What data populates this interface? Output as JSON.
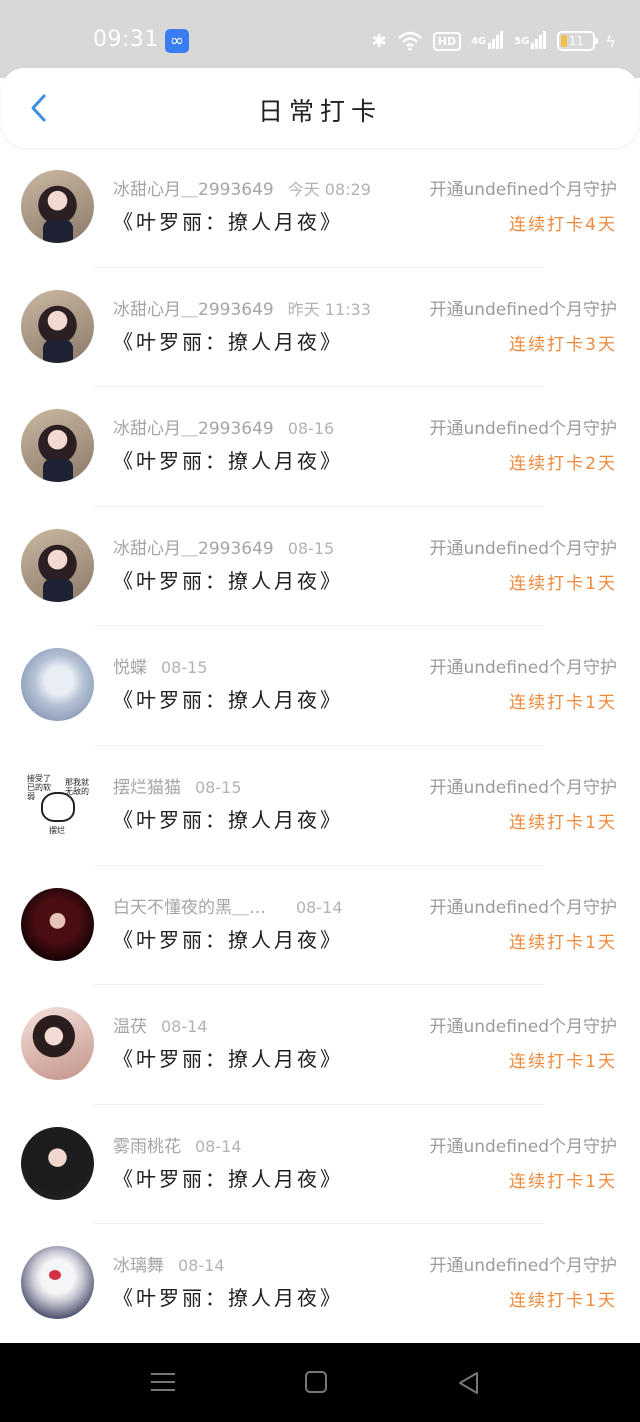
{
  "status_bar": {
    "time": "09:31",
    "app_icon": "infinity-app-icon",
    "hd_label": "HD",
    "net1_label": "4G",
    "net2_label": "5G",
    "battery": "11"
  },
  "header": {
    "title": "日常打卡",
    "back_icon": "chevron-left-icon"
  },
  "colors": {
    "accent": "#3a8ee6",
    "streak": "#ef8a3c",
    "meta_text": "#a5a5a5"
  },
  "items": [
    {
      "name": "冰甜心月＿2993649",
      "date": "今天 08:29",
      "guard": "开通undefined个月守护",
      "book": "《叶罗丽：撩人月夜》",
      "streak": "连续打卡4天",
      "avatar": "girl"
    },
    {
      "name": "冰甜心月＿2993649",
      "date": "昨天 11:33",
      "guard": "开通undefined个月守护",
      "book": "《叶罗丽：撩人月夜》",
      "streak": "连续打卡3天",
      "avatar": "girl"
    },
    {
      "name": "冰甜心月＿2993649",
      "date": "08-16",
      "guard": "开通undefined个月守护",
      "book": "《叶罗丽：撩人月夜》",
      "streak": "连续打卡2天",
      "avatar": "girl"
    },
    {
      "name": "冰甜心月＿2993649",
      "date": "08-15",
      "guard": "开通undefined个月守护",
      "book": "《叶罗丽：撩人月夜》",
      "streak": "连续打卡1天",
      "avatar": "girl"
    },
    {
      "name": "悦蝶",
      "date": "08-15",
      "guard": "开通undefined个月守护",
      "book": "《叶罗丽：撩人月夜》",
      "streak": "连续打卡1天",
      "avatar": "white"
    },
    {
      "name": "摆烂猫猫",
      "date": "08-15",
      "guard": "开通undefined个月守护",
      "book": "《叶罗丽：撩人月夜》",
      "streak": "连续打卡1天",
      "avatar": "meme"
    },
    {
      "name": "白天不懂夜的黑＿…",
      "date": "08-14",
      "guard": "开通undefined个月守护",
      "book": "《叶罗丽：撩人月夜》",
      "streak": "连续打卡1天",
      "avatar": "red"
    },
    {
      "name": "温茯",
      "date": "08-14",
      "guard": "开通undefined个月守护",
      "book": "《叶罗丽：撩人月夜》",
      "streak": "连续打卡1天",
      "avatar": "lady"
    },
    {
      "name": "雾雨桃花",
      "date": "08-14",
      "guard": "开通undefined个月守护",
      "book": "《叶罗丽：撩人月夜》",
      "streak": "连续打卡1天",
      "avatar": "dark"
    },
    {
      "name": "冰璃舞",
      "date": "08-14",
      "guard": "开通undefined个月守护",
      "book": "《叶罗丽：撩人月夜》",
      "streak": "连续打卡1天",
      "avatar": "ghost"
    }
  ],
  "meme_text": {
    "line1": "接受了 已的软弱",
    "line2": "那我就 无敌的",
    "line3": "摆烂"
  },
  "nav": {
    "menu_icon": "menu-icon",
    "home_icon": "home-square-icon",
    "back_icon": "triangle-back-icon"
  }
}
